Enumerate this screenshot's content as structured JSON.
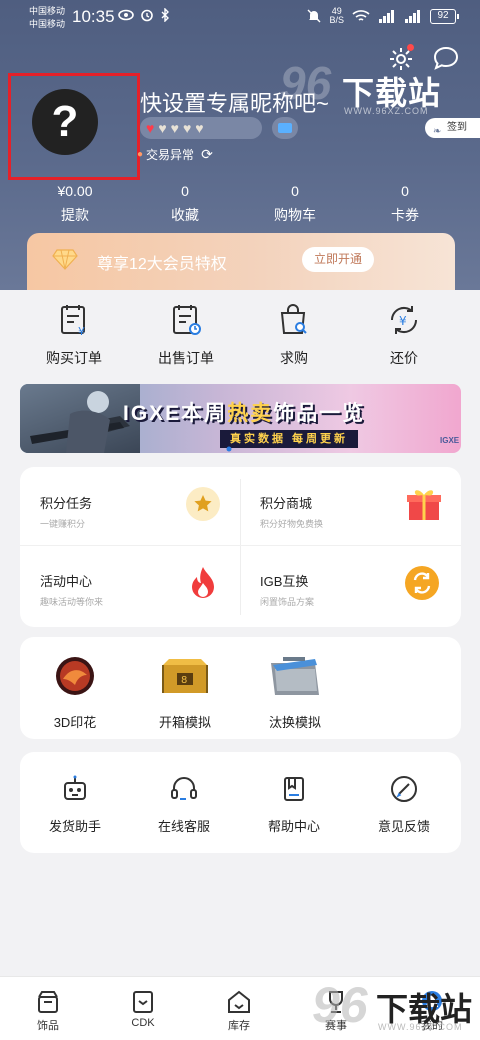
{
  "status_bar": {
    "carrier_1": "中国移动",
    "carrier_2": "中国移动",
    "time": "10:35",
    "net_speed": "49",
    "net_unit": "B/S",
    "battery": "92"
  },
  "profile": {
    "avatar_glyph": "?",
    "nickname": "快设置专属昵称吧~",
    "hearts_filled": 1,
    "hearts_total": 5,
    "trade_status": "交易异常",
    "signin_label": "签到"
  },
  "watermark": {
    "number": "96",
    "text": "下载站",
    "url": "WWW.96XZ.COM"
  },
  "stats": [
    {
      "value": "¥0.00",
      "label": "提款"
    },
    {
      "value": "0",
      "label": "收藏"
    },
    {
      "value": "0",
      "label": "购物车"
    },
    {
      "value": "0",
      "label": "卡券"
    }
  ],
  "vip": {
    "text": "尊享12大会员特权",
    "button": "立即开通"
  },
  "orders": [
    {
      "label": "购买订单",
      "icon": "buy-order-icon"
    },
    {
      "label": "出售订单",
      "icon": "sell-order-icon"
    },
    {
      "label": "求购",
      "icon": "wanted-bag-icon"
    },
    {
      "label": "还价",
      "icon": "bargain-icon"
    }
  ],
  "banner": {
    "title_pre": "IGXE本周",
    "title_hl": "热卖",
    "title_post": "饰品一览",
    "subtitle": "真实数据 每周更新",
    "logo": "IGXE"
  },
  "features": [
    {
      "title": "积分任务",
      "subtitle": "一键赚积分",
      "icon": "star-coin-icon"
    },
    {
      "title": "积分商城",
      "subtitle": "积分好物免费换",
      "icon": "gift-box-icon"
    },
    {
      "title": "活动中心",
      "subtitle": "趣味活动等你来",
      "icon": "flame-icon"
    },
    {
      "title": "IGB互换",
      "subtitle": "闲置饰品方案",
      "icon": "exchange-coin-icon"
    }
  ],
  "simulators": [
    {
      "label": "3D印花",
      "icon": "sticker-icon"
    },
    {
      "label": "开箱模拟",
      "icon": "case-icon"
    },
    {
      "label": "汰换模拟",
      "icon": "trade-up-icon"
    }
  ],
  "services": [
    {
      "label": "发货助手",
      "icon": "robot-icon"
    },
    {
      "label": "在线客服",
      "icon": "headset-icon"
    },
    {
      "label": "帮助中心",
      "icon": "book-icon"
    },
    {
      "label": "意见反馈",
      "icon": "feedback-pen-icon"
    }
  ],
  "nav": [
    {
      "label": "饰品",
      "icon": "store-icon"
    },
    {
      "label": "CDK",
      "icon": "cdk-icon"
    },
    {
      "label": "库存",
      "icon": "inventory-icon"
    },
    {
      "label": "赛事",
      "icon": "trophy-icon"
    },
    {
      "label": "我的",
      "icon": "profile-icon"
    }
  ],
  "colors": {
    "header": "#55648a",
    "accent_red": "#e52129",
    "vip_gold": "#f6c7a3"
  }
}
